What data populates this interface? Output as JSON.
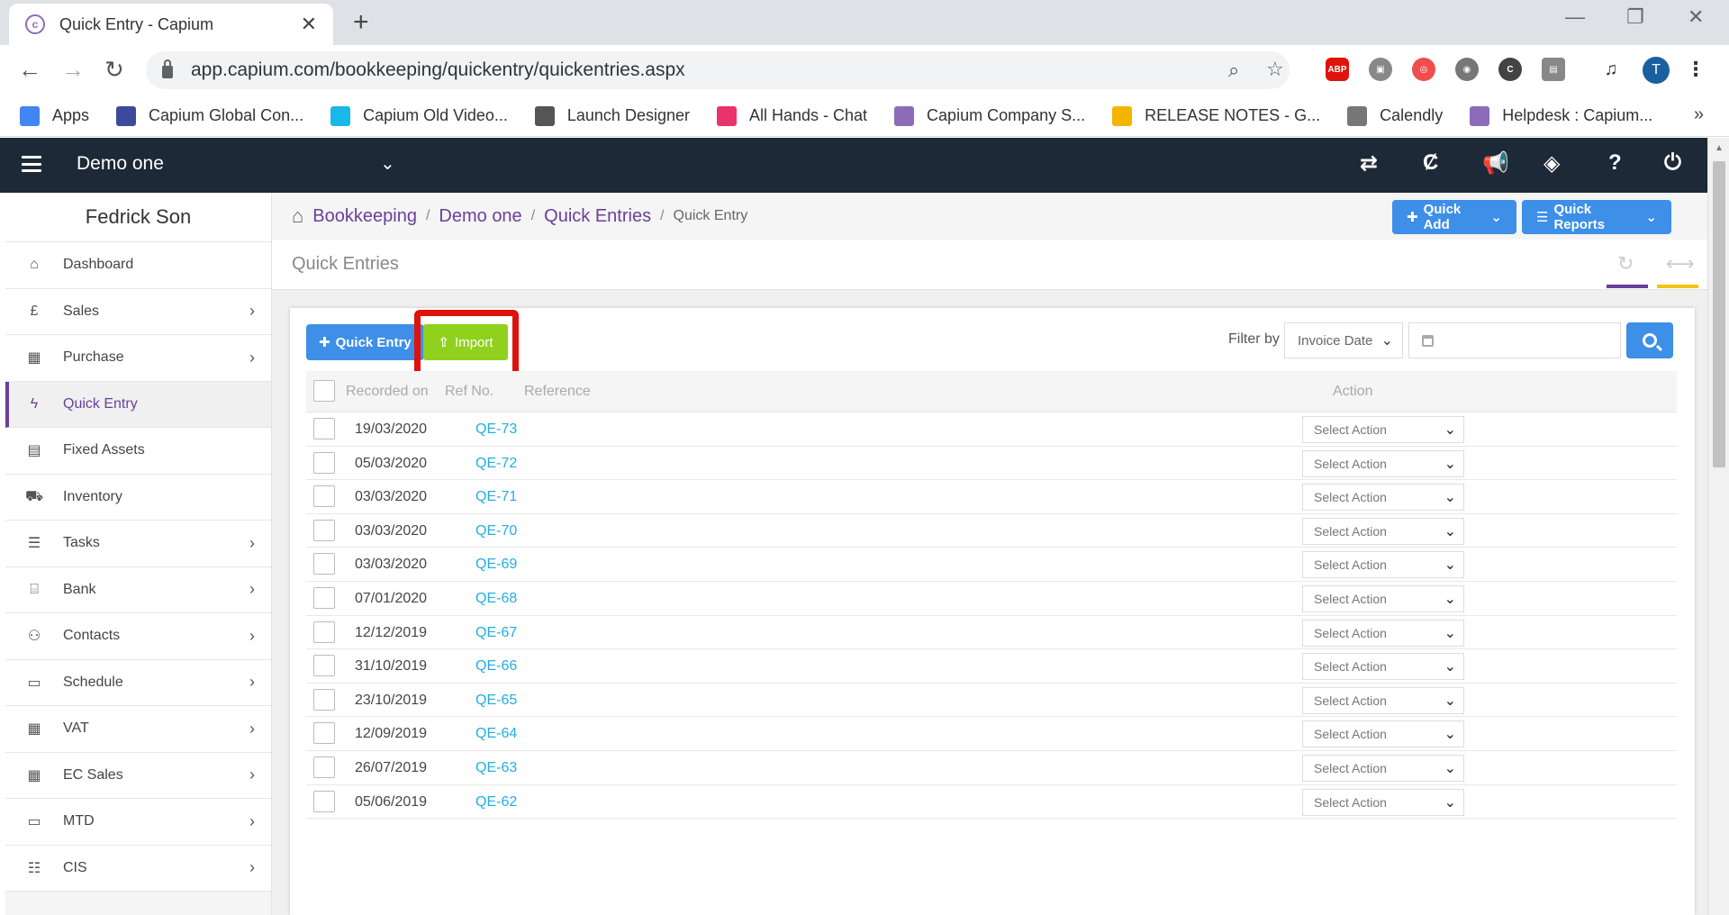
{
  "browser": {
    "tab_title": "Quick Entry - Capium",
    "url": "app.capium.com/bookkeeping/quickentry/quickentries.aspx",
    "profile_initial": "T",
    "bookmarks": [
      {
        "label": "Apps",
        "icon": "apps-grid-icon",
        "color": "#4285f4"
      },
      {
        "label": "Capium Global Con...",
        "icon": "calendar-icon",
        "color": "#3c4a9e"
      },
      {
        "label": "Capium Old Video...",
        "icon": "vimeo-icon",
        "color": "#1ab7ea"
      },
      {
        "label": "Launch Designer",
        "icon": "globe-icon",
        "color": "#555555"
      },
      {
        "label": "All Hands - Chat",
        "icon": "chat-icon",
        "color": "#e8336b"
      },
      {
        "label": "Capium Company S...",
        "icon": "capium-icon",
        "color": "#8e6bb8"
      },
      {
        "label": "RELEASE NOTES - G...",
        "icon": "drive-icon",
        "color": "#f4b400"
      },
      {
        "label": "Calendly",
        "icon": "calendly-icon",
        "color": "#777777"
      },
      {
        "label": "Helpdesk : Capium...",
        "icon": "capium-icon",
        "color": "#8e6bb8"
      }
    ],
    "bookmarks_more": "»"
  },
  "app": {
    "company": "Demo one",
    "user": "Fedrick Son",
    "brand_color": "#6a3f9c",
    "header_bg": "#1e2937"
  },
  "sidebar": {
    "items": [
      {
        "label": "Dashboard",
        "icon": "home-icon",
        "glyph": "⌂",
        "chevron": false,
        "active": false
      },
      {
        "label": "Sales",
        "icon": "pound-icon",
        "glyph": "£",
        "chevron": true,
        "active": false
      },
      {
        "label": "Purchase",
        "icon": "qrcode-icon",
        "glyph": "▦",
        "chevron": true,
        "active": false
      },
      {
        "label": "Quick Entry",
        "icon": "bolt-icon",
        "glyph": "ϟ",
        "chevron": false,
        "active": true
      },
      {
        "label": "Fixed Assets",
        "icon": "building-icon",
        "glyph": "▤",
        "chevron": false,
        "active": false
      },
      {
        "label": "Inventory",
        "icon": "truck-icon",
        "glyph": "⛟",
        "chevron": false,
        "active": false
      },
      {
        "label": "Tasks",
        "icon": "tasks-icon",
        "glyph": "☰",
        "chevron": true,
        "active": false
      },
      {
        "label": "Bank",
        "icon": "bank-icon",
        "glyph": "⌸",
        "chevron": true,
        "active": false
      },
      {
        "label": "Contacts",
        "icon": "users-icon",
        "glyph": "⚇",
        "chevron": true,
        "active": false
      },
      {
        "label": "Schedule",
        "icon": "calendar-icon",
        "glyph": "▭",
        "chevron": true,
        "active": false
      },
      {
        "label": "VAT",
        "icon": "calculator-icon",
        "glyph": "▦",
        "chevron": true,
        "active": false
      },
      {
        "label": "EC Sales",
        "icon": "calculator-icon",
        "glyph": "▦",
        "chevron": true,
        "active": false
      },
      {
        "label": "MTD",
        "icon": "calendar-icon",
        "glyph": "▭",
        "chevron": true,
        "active": false
      },
      {
        "label": "CIS",
        "icon": "list-icon",
        "glyph": "☷",
        "chevron": true,
        "active": false
      }
    ]
  },
  "breadcrumb": {
    "items": [
      "Bookkeeping",
      "Demo one",
      "Quick Entries"
    ],
    "current": "Quick Entry"
  },
  "header_buttons": {
    "quick_add": "Quick Add",
    "quick_reports": "Quick Reports"
  },
  "page": {
    "title": "Quick Entries",
    "accent_purple": "#6a3f9c",
    "accent_yellow": "#f2c511"
  },
  "toolbar": {
    "quick_entry_label": "Quick Entry",
    "import_label": "Import",
    "filter_label": "Filter by",
    "filter_value": "Invoice Date",
    "date_placeholder": ""
  },
  "table": {
    "columns": {
      "recorded_on": "Recorded on",
      "ref_no": "Ref No.",
      "reference": "Reference",
      "action": "Action"
    },
    "action_placeholder": "Select Action",
    "rows": [
      {
        "date": "19/03/2020",
        "ref": "QE-73"
      },
      {
        "date": "05/03/2020",
        "ref": "QE-72"
      },
      {
        "date": "03/03/2020",
        "ref": "QE-71"
      },
      {
        "date": "03/03/2020",
        "ref": "QE-70"
      },
      {
        "date": "03/03/2020",
        "ref": "QE-69"
      },
      {
        "date": "07/01/2020",
        "ref": "QE-68"
      },
      {
        "date": "12/12/2019",
        "ref": "QE-67"
      },
      {
        "date": "31/10/2019",
        "ref": "QE-66"
      },
      {
        "date": "23/10/2019",
        "ref": "QE-65"
      },
      {
        "date": "12/09/2019",
        "ref": "QE-64"
      },
      {
        "date": "26/07/2019",
        "ref": "QE-63"
      },
      {
        "date": "05/06/2019",
        "ref": "QE-62"
      }
    ]
  }
}
